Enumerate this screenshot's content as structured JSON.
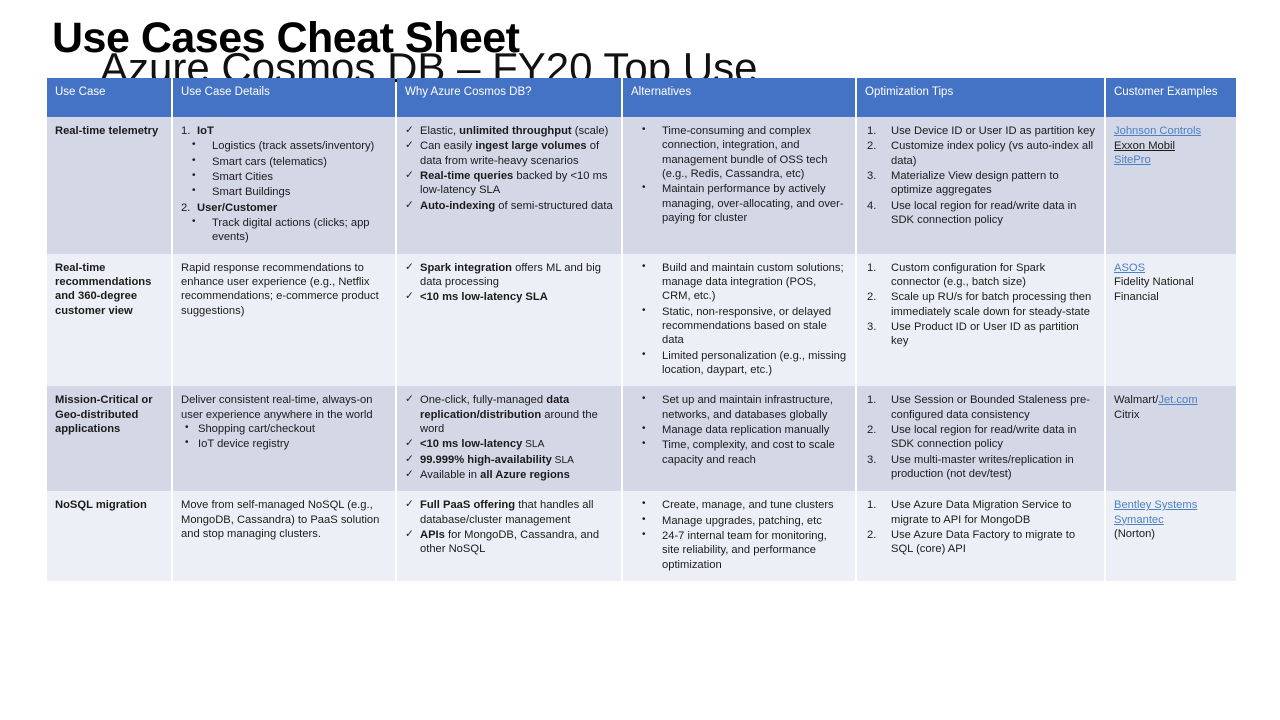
{
  "title": {
    "main": "Use Cases Cheat Sheet",
    "sub": "Azure Cosmos DB – FY20 Top Use"
  },
  "table": {
    "headers": [
      "Use Case",
      "Use Case Details",
      "Why Azure Cosmos DB?",
      "Alternatives",
      "Optimization Tips",
      "Customer Examples"
    ],
    "rows": [
      {
        "use_case": "Real-time telemetry",
        "details": {
          "items": [
            {
              "marker": "1.",
              "text": "IoT",
              "bold": true
            },
            {
              "marker": "•",
              "text": "Logistics (track assets/inventory)"
            },
            {
              "marker": "•",
              "text": "Smart cars (telematics)"
            },
            {
              "marker": "•",
              "text": "Smart Cities"
            },
            {
              "marker": "•",
              "text": "Smart Buildings"
            },
            {
              "marker": "2.",
              "text": "User/Customer",
              "bold": true
            },
            {
              "marker": "•",
              "text": "Track digital actions (clicks; app events)"
            }
          ]
        },
        "why": [
          {
            "pre": "Elastic, ",
            "bold": "unlimited throughput",
            "post": " (scale)"
          },
          {
            "pre": "Can easily ",
            "bold": "ingest large volumes",
            "post": " of data from write-heavy scenarios"
          },
          {
            "pre": "",
            "bold": "Real-time queries",
            "post": " backed by <10 ms low-latency SLA"
          },
          {
            "pre": "",
            "bold": "Auto-indexing",
            "post": " of semi-structured data"
          }
        ],
        "alternatives": [
          "Time-consuming and complex connection, integration, and management bundle of OSS tech (e.g., Redis, Cassandra, etc)",
          "Maintain performance by actively managing, over-allocating, and over-paying for cluster"
        ],
        "optimization": [
          "Use Device ID or User ID as partition key",
          "Customize index policy (vs auto-index all data)",
          "Materialize View design pattern to optimize aggregates",
          "Use local region for read/write data in SDK connection policy"
        ],
        "customers": [
          {
            "text": "Johnson Controls",
            "style": "link"
          },
          {
            "text": "Exxon Mobil",
            "style": "underline"
          },
          {
            "text": "SitePro",
            "style": "link"
          }
        ]
      },
      {
        "use_case": "Real-time recommendations and 360-degree customer view",
        "details": {
          "paragraph": "Rapid response recommendations to enhance user experience (e.g., Netflix recommendations; e-commerce product suggestions)"
        },
        "why": [
          {
            "pre": "",
            "bold": "Spark integration",
            "post": " offers ML and big data processing"
          },
          {
            "pre": "",
            "bold": "<10 ms low-latency SLA",
            "post": ""
          }
        ],
        "alternatives": [
          "Build and maintain custom solutions; manage data integration (POS, CRM, etc.)",
          "Static, non-responsive, or delayed recommendations based on stale data",
          "Limited personalization (e.g., missing location, daypart, etc.)"
        ],
        "optimization": [
          "Custom configuration for Spark connector (e.g., batch size)",
          "Scale up RU/s for batch processing then immediately scale down for steady-state",
          "Use Product ID or User ID as partition key"
        ],
        "customers": [
          {
            "text": "ASOS",
            "style": "link"
          },
          {
            "text": "Fidelity National Financial",
            "style": "plain"
          }
        ]
      },
      {
        "use_case": "Mission-Critical or Geo-distributed applications",
        "details": {
          "paragraph": "Deliver consistent real-time, always-on user experience anywhere in the world",
          "bullets": [
            "Shopping cart/checkout",
            "IoT device registry"
          ]
        },
        "why": [
          {
            "pre": "One-click, fully-managed ",
            "bold": "data replication/distribution",
            "post": " around the word"
          },
          {
            "pre": "",
            "bold": "<10 ms low-latency",
            "post": " SLA",
            "post_small": true
          },
          {
            "pre": "",
            "bold": "99.999% high-availability",
            "post": " SLA",
            "post_small": true
          },
          {
            "pre": "Available in ",
            "bold": "all Azure regions",
            "post": ""
          }
        ],
        "alternatives": [
          "Set up and maintain infrastructure, networks, and databases globally",
          "Manage data replication manually",
          "Time, complexity, and cost to scale capacity and reach"
        ],
        "optimization": [
          "Use Session or Bounded Staleness pre-configured data consistency",
          "Use local region for read/write data in SDK connection policy",
          "Use multi-master writes/replication in production (not dev/test)"
        ],
        "customers": [
          {
            "text": "Walmart/",
            "style": "plain",
            "link_suffix": "Jet.com"
          },
          {
            "text": "Citrix",
            "style": "plain"
          }
        ]
      },
      {
        "use_case": "NoSQL migration",
        "details": {
          "paragraph": "Move from self-managed NoSQL (e.g., MongoDB, Cassandra) to PaaS solution and stop managing clusters."
        },
        "why": [
          {
            "pre": "",
            "bold": "Full PaaS offering",
            "post": " that handles all database/cluster management"
          },
          {
            "pre": "",
            "bold": "APIs",
            "post": " for MongoDB, Cassandra, and other NoSQL"
          }
        ],
        "alternatives": [
          "Create, manage, and tune clusters",
          "Manage upgrades, patching, etc",
          "24-7 internal team for monitoring, site reliability, and performance optimization"
        ],
        "optimization": [
          "Use Azure Data Migration Service to migrate to API for MongoDB",
          "Use Azure Data Factory to migrate to SQL (core) API"
        ],
        "customers": [
          {
            "text": "Bentley Systems",
            "style": "link"
          },
          {
            "text": "Symantec",
            "style": "link"
          },
          {
            "text": "(Norton)",
            "style": "plain"
          }
        ]
      }
    ]
  },
  "icons": {
    "check": "✓",
    "bullet": "•"
  },
  "colors": {
    "header_blue": "#4472C4",
    "band_dark": "#D3D7E6",
    "band_light": "#EDEFF6",
    "link_blue": "#4A81C6"
  }
}
